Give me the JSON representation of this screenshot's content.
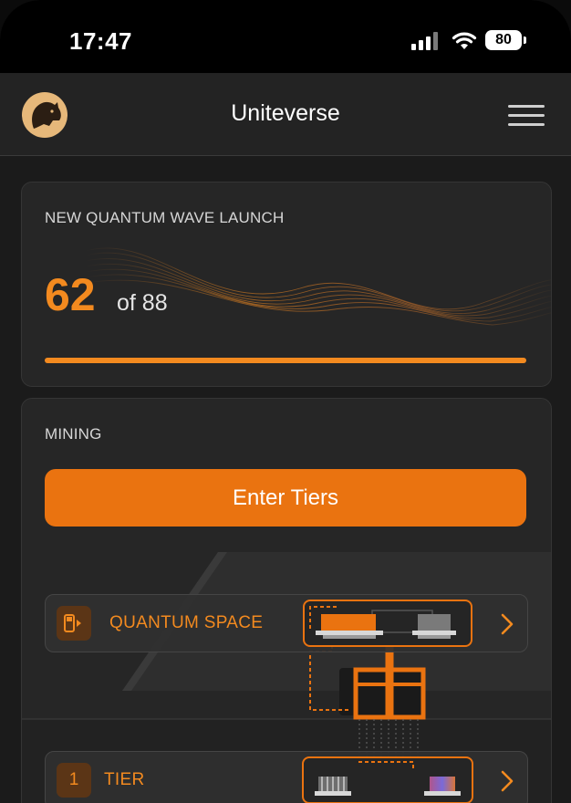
{
  "status_bar": {
    "time": "17:47",
    "battery": "80",
    "icons": [
      "signal-icon",
      "wifi-icon",
      "battery-icon"
    ]
  },
  "header": {
    "title": "Uniteverse",
    "logo_icon": "puma-logo-icon",
    "menu_icon": "hamburger-menu-icon"
  },
  "launch": {
    "label": "NEW QUANTUM WAVE LAUNCH",
    "current": "62",
    "of_text": "of 88",
    "progress_fraction": 1.0
  },
  "mining": {
    "label": "MINING",
    "button_label": "Enter Tiers",
    "rows": [
      {
        "icon": "fuel-pump-icon",
        "label": "QUANTUM SPACE"
      },
      {
        "badge": "1",
        "label": "TIER"
      }
    ]
  },
  "colors": {
    "accent": "#f38a1f",
    "button": "#ea7310",
    "background": "#1b1b1b",
    "card": "#262626"
  }
}
